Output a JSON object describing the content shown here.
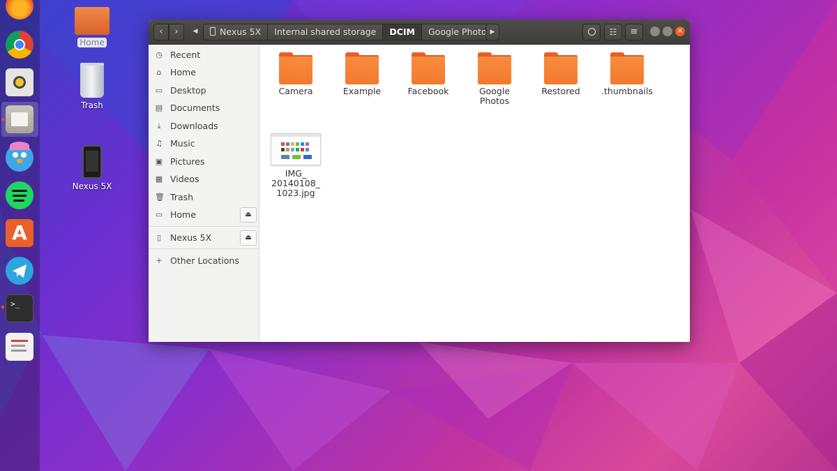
{
  "desktop": {
    "icons": [
      {
        "label": "Home",
        "selected": true
      },
      {
        "label": "Trash",
        "selected": false
      },
      {
        "label": "Nexus 5X",
        "selected": false
      }
    ]
  },
  "dock": {
    "apps": [
      "firefox-icon",
      "chrome-icon",
      "rhythmbox-icon",
      "files-icon",
      "cawbird-icon",
      "spotify-icon",
      "ubuntu-software-icon",
      "telegram-icon",
      "terminal-icon",
      "text-editor-icon"
    ]
  },
  "window": {
    "breadcrumbs": [
      "Nexus 5X",
      "Internal shared storage",
      "DCIM",
      "Google Photos"
    ],
    "active_crumb": "DCIM",
    "sidebar": {
      "places": [
        {
          "label": "Recent",
          "icon": "clock-icon"
        },
        {
          "label": "Home",
          "icon": "home-icon"
        },
        {
          "label": "Desktop",
          "icon": "desktop-icon"
        },
        {
          "label": "Documents",
          "icon": "document-icon"
        },
        {
          "label": "Downloads",
          "icon": "download-icon"
        },
        {
          "label": "Music",
          "icon": "music-icon"
        },
        {
          "label": "Pictures",
          "icon": "picture-icon"
        },
        {
          "label": "Videos",
          "icon": "video-icon"
        },
        {
          "label": "Trash",
          "icon": "trash-icon"
        },
        {
          "label": "Home",
          "icon": "drive-icon"
        }
      ],
      "devices": [
        {
          "label": "Nexus 5X",
          "icon": "phone-icon"
        }
      ],
      "other": {
        "label": "Other Locations",
        "icon": "plus-icon"
      }
    },
    "items": [
      {
        "type": "folder",
        "name": "Camera"
      },
      {
        "type": "folder",
        "name": "Example"
      },
      {
        "type": "folder",
        "name": "Facebook"
      },
      {
        "type": "folder",
        "name": "Google\nPhotos"
      },
      {
        "type": "folder",
        "name": "Restored"
      },
      {
        "type": "folder",
        "name": ".thumbnails"
      },
      {
        "type": "image",
        "name": "IMG_\n20140108_\n1023.jpg"
      }
    ]
  },
  "colors": {
    "accent": "#e95420",
    "folder": "#f27a2e"
  }
}
